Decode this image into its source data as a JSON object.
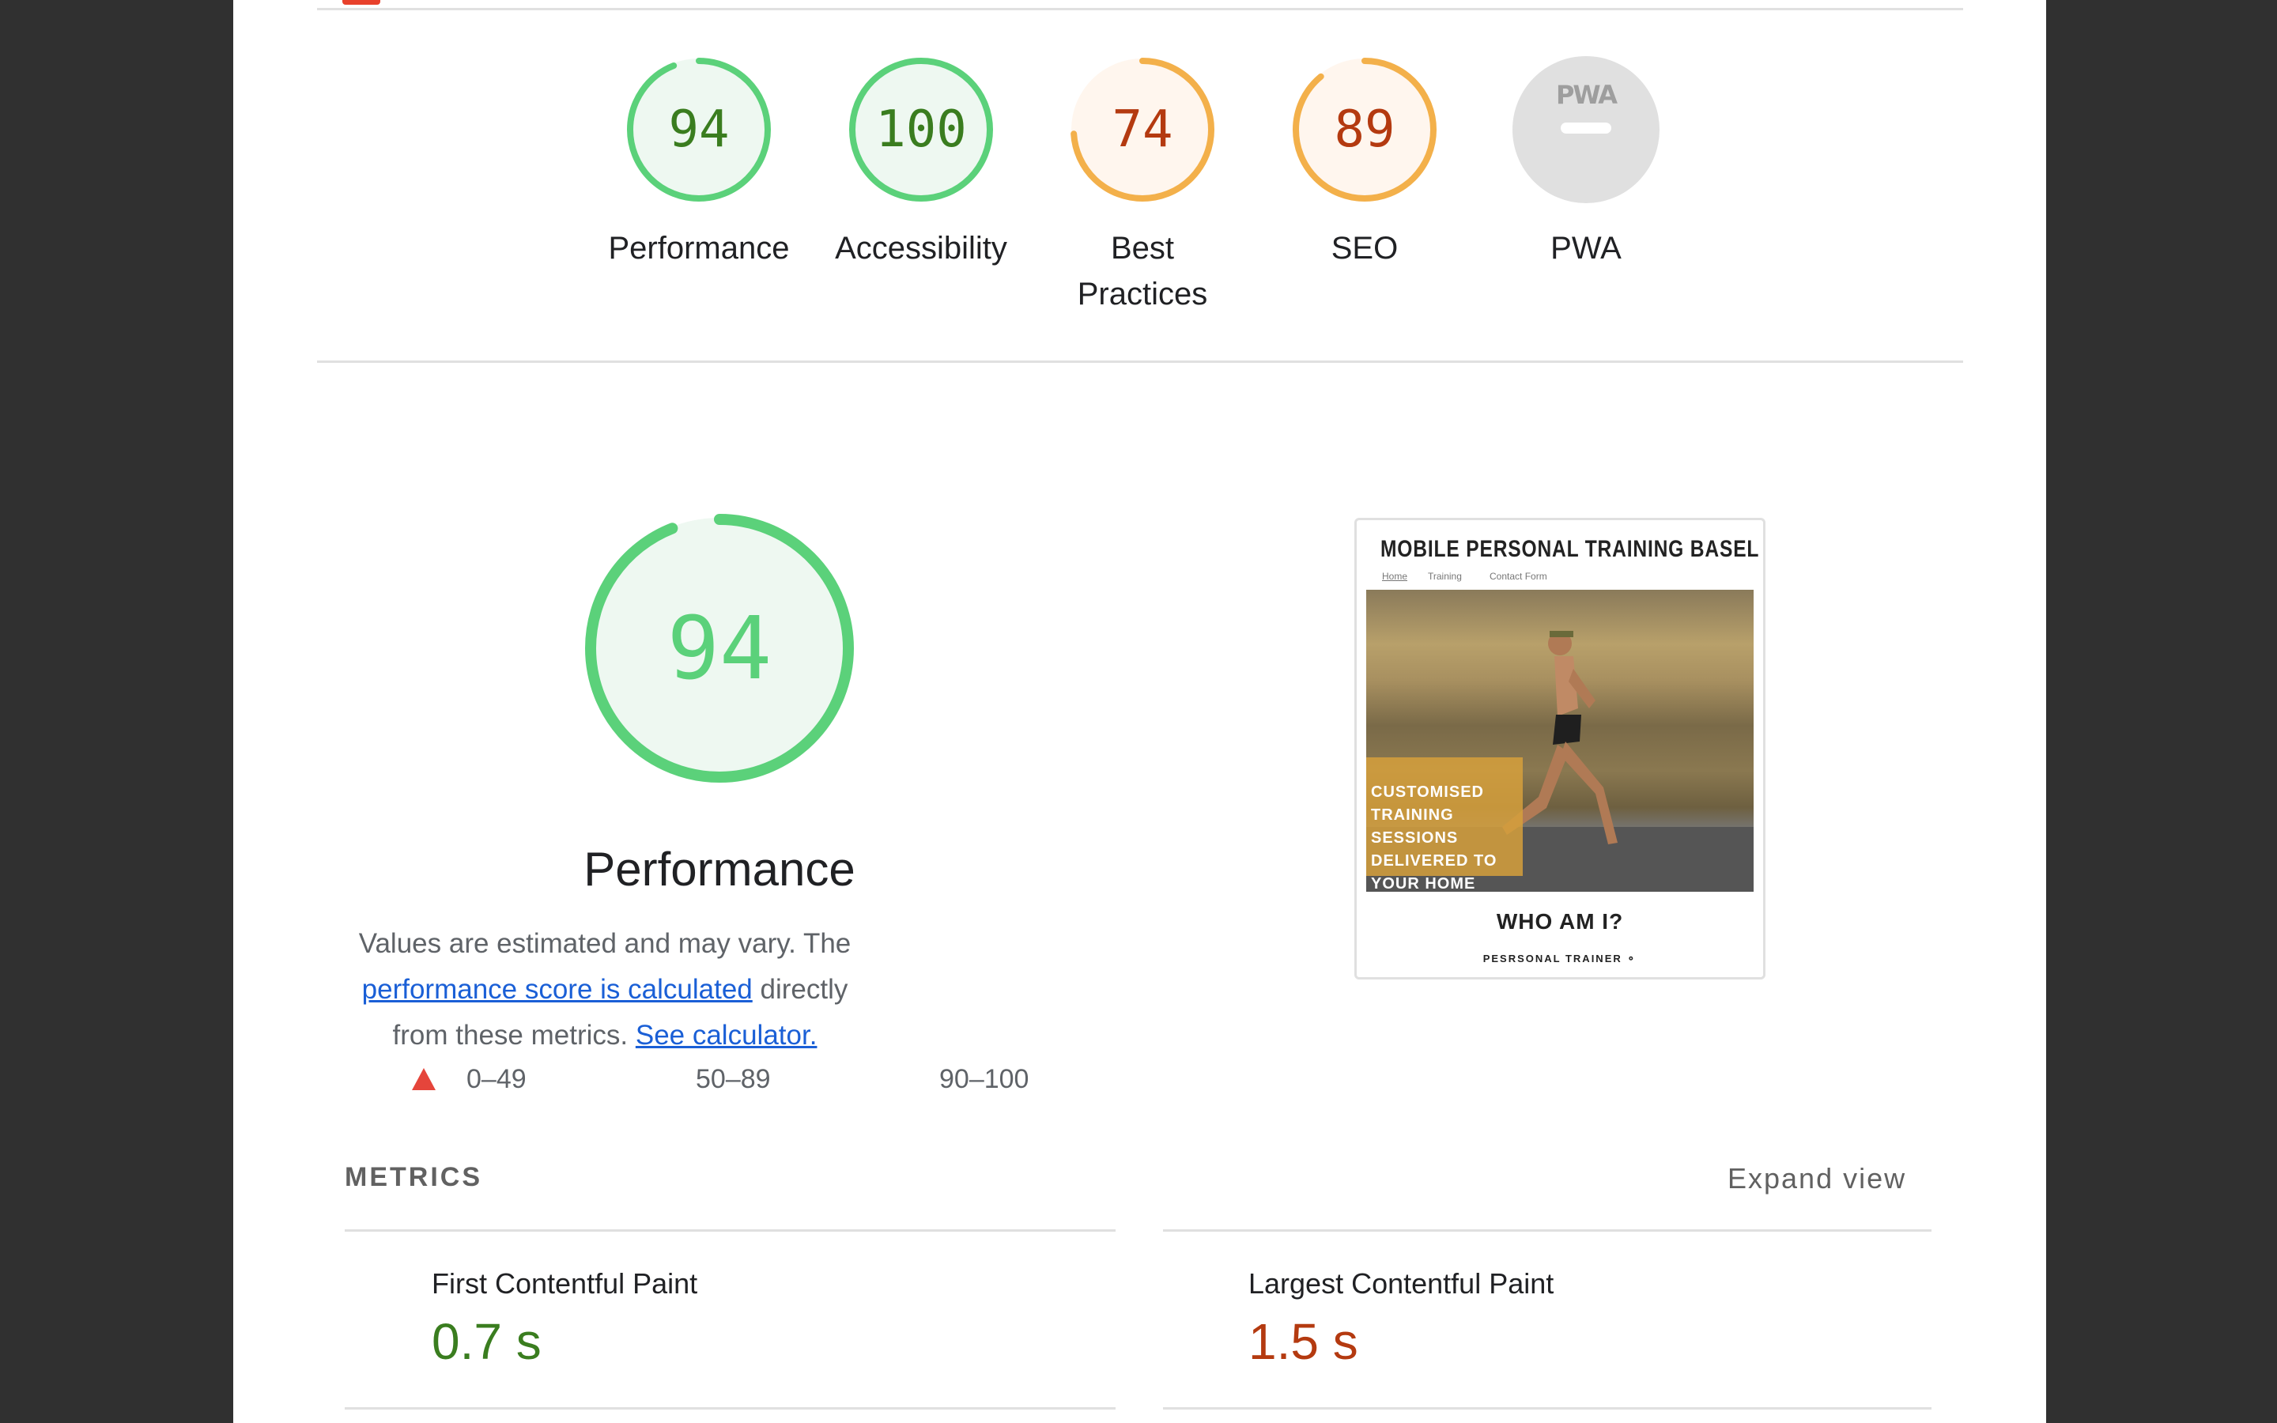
{
  "scores": [
    {
      "label": "Performance",
      "value": "94",
      "score": 94,
      "rating": "pass"
    },
    {
      "label": "Accessibility",
      "value": "100",
      "score": 100,
      "rating": "pass"
    },
    {
      "label_line1": "Best",
      "label_line2": "Practices",
      "value": "74",
      "score": 74,
      "rating": "average"
    },
    {
      "label": "SEO",
      "value": "89",
      "score": 89,
      "rating": "average"
    },
    {
      "label": "PWA",
      "icon_text": "PWA",
      "rating": "na"
    }
  ],
  "colors": {
    "pass_arc": "#5bd17a",
    "pass_text": "#3a7d1f",
    "pass_fill": "#eef8f1",
    "average_arc": "#f3b04a",
    "average_text": "#b43a10",
    "average_fill": "#fff6ee",
    "fail": "#e5453b",
    "na_fill": "#e0e0e0",
    "link": "#1a5fd6"
  },
  "performance": {
    "value": "94",
    "score": 94,
    "title": "Performance",
    "desc_prefix": "Values are estimated and may vary. The ",
    "link_score": "performance score is calculated",
    "desc_middle": " directly from these metrics. ",
    "link_calc": "See calculator.",
    "legend": [
      "0–49",
      "50–89",
      "90–100"
    ]
  },
  "screenshot": {
    "site_title": "MOBILE PERSONAL TRAINING BASEL",
    "nav": [
      "Home",
      "Training",
      "Contact Form"
    ],
    "overlay_text": "CUSTOMISED TRAINING SESSIONS DELIVERED TO YOUR HOME",
    "heading": "WHO AM I?",
    "footer": "PESRSONAL TRAINER"
  },
  "metrics": {
    "title": "METRICS",
    "expand": "Expand view",
    "items": [
      {
        "name": "First Contentful Paint",
        "value": "0.7 s",
        "rating": "pass"
      },
      {
        "name": "Largest Contentful Paint",
        "value": "1.5 s",
        "rating": "average"
      }
    ]
  }
}
